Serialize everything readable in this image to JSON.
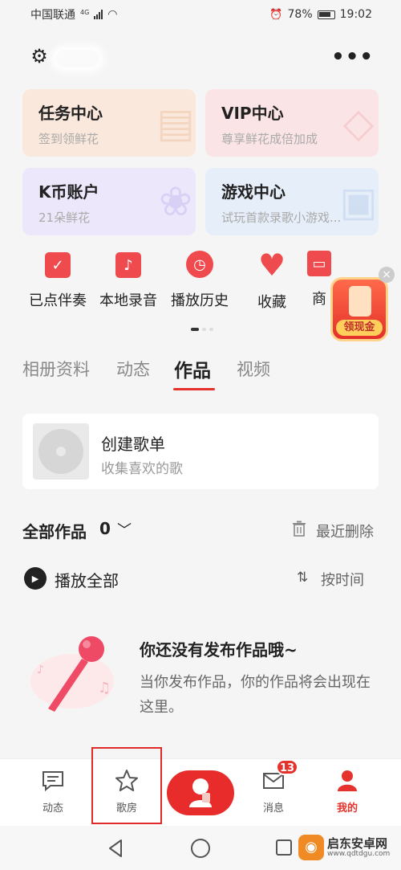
{
  "status_bar": {
    "carrier": "中国联通",
    "network": "4G",
    "battery": "78%",
    "time": "19:02"
  },
  "header": {
    "settings_icon": "gear-icon",
    "more_icon": "more-dots-icon"
  },
  "cards": [
    {
      "title": "任务中心",
      "subtitle": "签到领鲜花",
      "color": "#fbe8dc"
    },
    {
      "title": "VIP中心",
      "subtitle": "尊享鲜花成倍加成",
      "color": "#fbe4e6"
    },
    {
      "title": "K币账户",
      "subtitle": "21朵鲜花",
      "color": "#ece7fb"
    },
    {
      "title": "游戏中心",
      "subtitle": "试玩首款录歌小游戏...",
      "color": "#e6eef9"
    }
  ],
  "shortcuts": [
    {
      "label": "已点伴奏",
      "icon": "checklist-icon"
    },
    {
      "label": "本地录音",
      "icon": "music-note-icon"
    },
    {
      "label": "播放历史",
      "icon": "clock-icon"
    },
    {
      "label": "收藏",
      "icon": "heart-icon"
    },
    {
      "label": "商",
      "icon": "store-icon"
    }
  ],
  "floating": {
    "label": "领现金"
  },
  "tabs": [
    {
      "label": "相册资料"
    },
    {
      "label": "动态"
    },
    {
      "label": "作品"
    },
    {
      "label": "视频"
    }
  ],
  "playlist": {
    "title": "创建歌单",
    "subtitle": "收集喜欢的歌"
  },
  "works": {
    "title": "全部作品",
    "count": "0",
    "recent_delete": "最近删除",
    "play_all": "播放全部",
    "sort": "按时间"
  },
  "empty_state": {
    "title": "你还没有发布作品哦~",
    "description": "当你发布作品，你的作品将会出现在这里。"
  },
  "bottom_nav": [
    {
      "label": "动态",
      "icon": "chat-icon"
    },
    {
      "label": "歌房",
      "icon": "star-icon"
    },
    {
      "label": "消息",
      "icon": "mail-icon",
      "badge": "13"
    },
    {
      "label": "我的",
      "icon": "person-icon"
    }
  ],
  "watermark": {
    "name": "启东安卓网",
    "url": "www.qdtdgu.com"
  },
  "colors": {
    "accent": "#e5322c"
  }
}
